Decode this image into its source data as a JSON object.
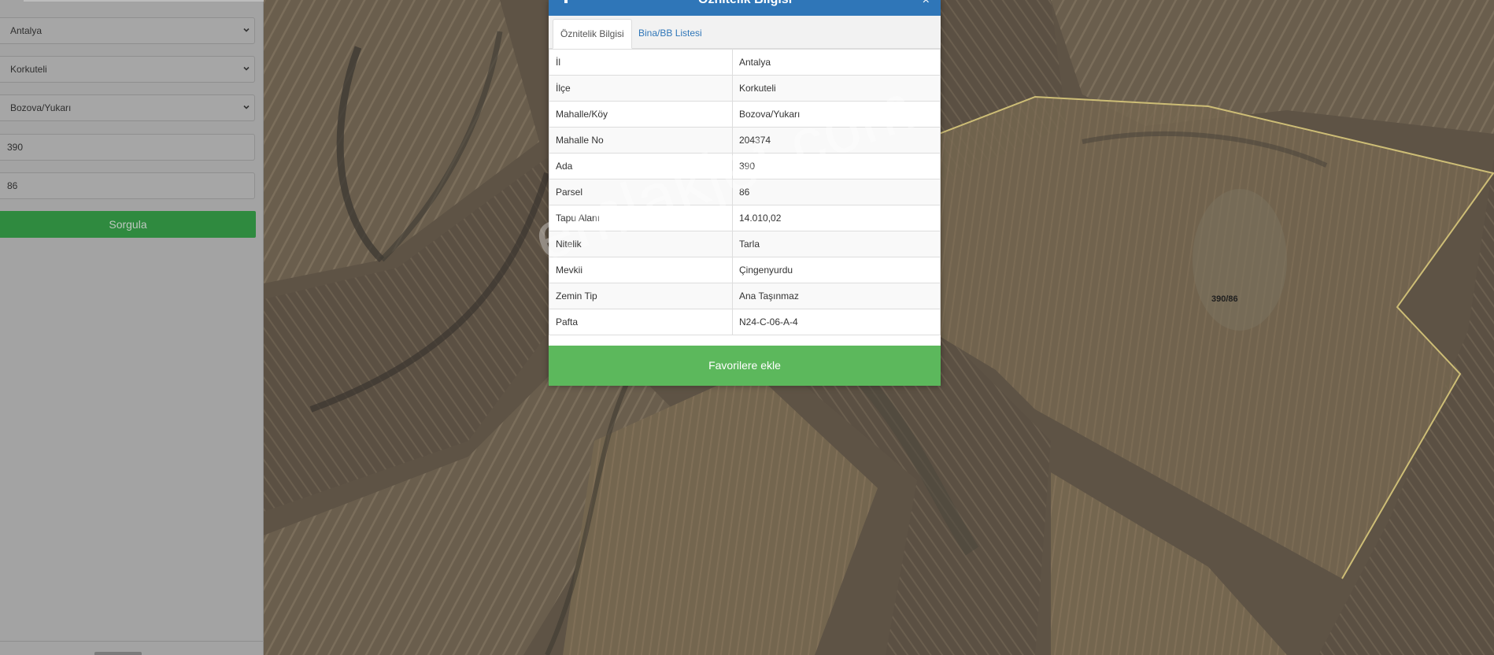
{
  "search_panel": {
    "province": "Antalya",
    "district": "Korkuteli",
    "neighborhood": "Bozova/Yukarı",
    "block": "390",
    "parcel": "86",
    "query_label": "Sorgula"
  },
  "map": {
    "parcel_label": "390/86",
    "parcel_outline_color": "#cdbd76",
    "watermark": "emlakjet.com"
  },
  "modal": {
    "title": "Öznitelik Bilgisi",
    "close_glyph": "×",
    "tabs": [
      {
        "label": "Öznitelik Bilgisi",
        "active": true
      },
      {
        "label": "Bina/BB Listesi",
        "active": false
      }
    ],
    "rows": [
      {
        "key": "İl",
        "value": "Antalya"
      },
      {
        "key": "İlçe",
        "value": "Korkuteli"
      },
      {
        "key": "Mahalle/Köy",
        "value": "Bozova/Yukarı"
      },
      {
        "key": "Mahalle No",
        "value": "204374"
      },
      {
        "key": "Ada",
        "value": "390"
      },
      {
        "key": "Parsel",
        "value": "86"
      },
      {
        "key": "Tapu Alanı",
        "value": "14.010,02"
      },
      {
        "key": "Nitelik",
        "value": "Tarla"
      },
      {
        "key": "Mevkii",
        "value": "Çingenyurdu"
      },
      {
        "key": "Zemin Tip",
        "value": "Ana Taşınmaz"
      },
      {
        "key": "Pafta",
        "value": "N24-C-06-A-4"
      }
    ],
    "favorite_label": "Favorilere ekle",
    "header_color": "#2f76b8",
    "favorite_color": "#5cb85c"
  }
}
